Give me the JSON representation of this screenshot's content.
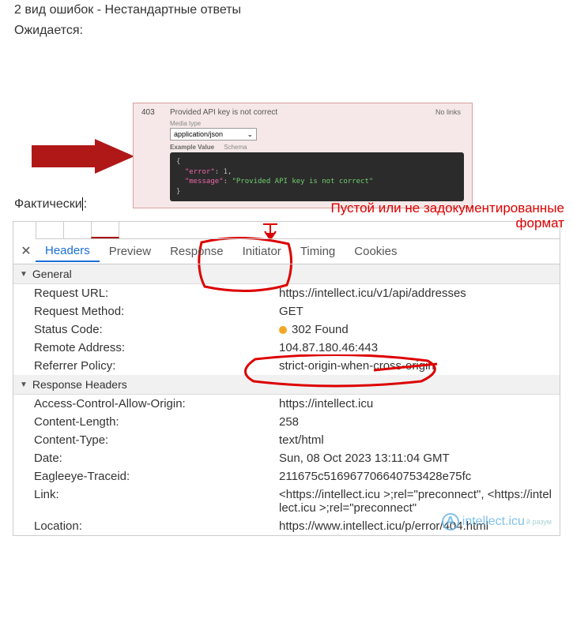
{
  "heading": "2 вид ошибок  - Нестандартные ответы",
  "expected_label": "Ожидается:",
  "actually_label": "Фактически",
  "swagger": {
    "code": "403",
    "desc": "Provided API key is not correct",
    "no_links": "No links",
    "media_label": "Media type",
    "media_value": "application/json",
    "tab_example": "Example Value",
    "tab_schema": "Schema",
    "json_line1_open": "{",
    "json_error_key": "\"error\"",
    "json_error_val": "1",
    "json_message_key": "\"message\"",
    "json_message_val": "\"Provided API key is not correct\"",
    "json_close": "}"
  },
  "annotation": {
    "line1": "Пустой или не задокументированные",
    "line2": "формат"
  },
  "devtools": {
    "tabs": [
      "Headers",
      "Preview",
      "Response",
      "Initiator",
      "Timing",
      "Cookies"
    ],
    "active_tab": 0,
    "sections": {
      "general": {
        "title": "General",
        "rows": [
          {
            "k": "Request URL:",
            "v": "https://intellect.icu/v1/api/addresses"
          },
          {
            "k": "Request Method:",
            "v": "GET"
          },
          {
            "k": "Status Code:",
            "v": "302 Found",
            "status_dot": true
          },
          {
            "k": "Remote Address:",
            "v": "104.87.180.46:443"
          },
          {
            "k": "Referrer Policy:",
            "v": "strict-origin-when-cross-origin"
          }
        ]
      },
      "response_headers": {
        "title": "Response Headers",
        "rows": [
          {
            "k": "Access-Control-Allow-Origin:",
            "v": "https://intellect.icu"
          },
          {
            "k": "Content-Length:",
            "v": "258"
          },
          {
            "k": "Content-Type:",
            "v": "text/html"
          },
          {
            "k": "Date:",
            "v": "Sun, 08 Oct 2023 13:11:04 GMT"
          },
          {
            "k": "Eagleeye-Traceid:",
            "v": "211675c516967706640753428e75fc"
          },
          {
            "k": "Link:",
            "v": "<https://intellect.icu >;rel=\"preconnect\", <https://intellect.icu >;rel=\"preconnect\""
          },
          {
            "k": "Location:",
            "v": "https://www.intellect.icu/p/error/404.html"
          }
        ]
      }
    }
  },
  "watermark": {
    "letter": "A",
    "text": "intellect.icu",
    "sub": "й разум"
  }
}
